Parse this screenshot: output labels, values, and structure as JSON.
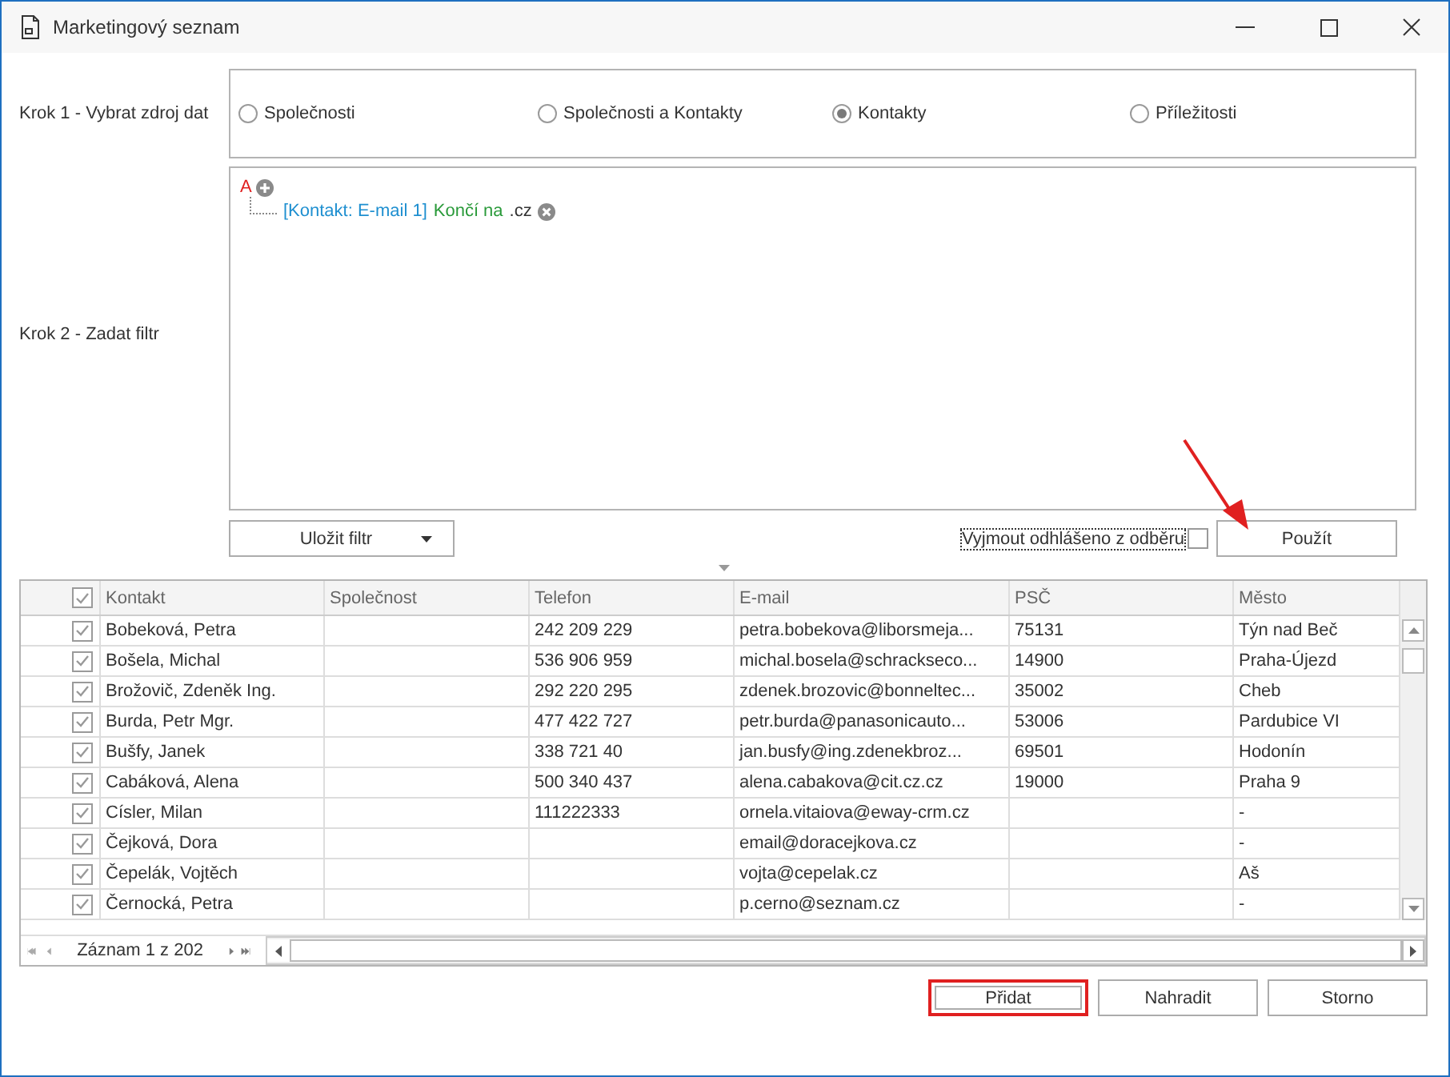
{
  "window": {
    "title": "Marketingový seznam"
  },
  "step1": {
    "label": "Krok 1 - Vybrat zdroj dat",
    "options": [
      {
        "label": "Společnosti",
        "selected": false
      },
      {
        "label": "Společnosti a Kontakty",
        "selected": false
      },
      {
        "label": "Kontakty",
        "selected": true
      },
      {
        "label": "Příležitosti",
        "selected": false
      }
    ]
  },
  "step2": {
    "label": "Krok 2 - Zadat filtr",
    "group_operator": "A",
    "condition": {
      "field": "[Kontakt: E-mail 1]",
      "operator": "Končí na",
      "value": ".cz"
    }
  },
  "save_filter_button": "Uložit filtr",
  "exclude_unsubscribed": {
    "label": "Vyjmout odhlášeno z odběru",
    "checked": false
  },
  "apply_button": "Použít",
  "table": {
    "header_checked": true,
    "columns": [
      "Kontakt",
      "Společnost",
      "Telefon",
      "E-mail",
      "PSČ",
      "Město"
    ],
    "rows": [
      {
        "checked": true,
        "cells": [
          "Bobeková, Petra",
          "",
          "242 209 229",
          "petra.bobekova@liborsmeja...",
          "75131",
          "Týn nad Beč"
        ]
      },
      {
        "checked": true,
        "cells": [
          "Bošela, Michal",
          "",
          "536 906 959",
          "michal.bosela@schrackseco...",
          "14900",
          "Praha-Újezd"
        ]
      },
      {
        "checked": true,
        "cells": [
          "Brožovič, Zdeněk Ing.",
          "",
          "292 220 295",
          "zdenek.brozovic@bonneltec...",
          "35002",
          "Cheb"
        ]
      },
      {
        "checked": true,
        "cells": [
          "Burda, Petr Mgr.",
          "",
          "477 422 727",
          "petr.burda@panasonicauto...",
          "53006",
          "Pardubice VI"
        ]
      },
      {
        "checked": true,
        "cells": [
          "Bušfy, Janek",
          "",
          "338 721 40",
          "jan.busfy@ing.zdenekbroz...",
          "69501",
          "Hodonín"
        ]
      },
      {
        "checked": true,
        "cells": [
          "Cabáková, Alena",
          "",
          "500 340 437",
          "alena.cabakova@cit.cz.cz",
          "19000",
          "Praha 9"
        ]
      },
      {
        "checked": true,
        "cells": [
          "Císler, Milan",
          "",
          "111222333",
          "ornela.vitaiova@eway-crm.cz",
          "",
          "-"
        ]
      },
      {
        "checked": true,
        "cells": [
          "Čejková, Dora",
          "",
          "",
          "email@doracejkova.cz",
          "",
          "-"
        ]
      },
      {
        "checked": true,
        "cells": [
          "Čepelák, Vojtěch",
          "",
          "",
          "vojta@cepelak.cz",
          "",
          "Aš"
        ]
      },
      {
        "checked": true,
        "cells": [
          "Černocká, Petra",
          "",
          "",
          "p.cerno@seznam.cz",
          "",
          "-"
        ]
      }
    ],
    "record_counter": "Záznam 1 z 202"
  },
  "buttons": [
    {
      "label": "Přidat",
      "highlighted": true
    },
    {
      "label": "Nahradit",
      "highlighted": false
    },
    {
      "label": "Storno",
      "highlighted": false
    }
  ]
}
